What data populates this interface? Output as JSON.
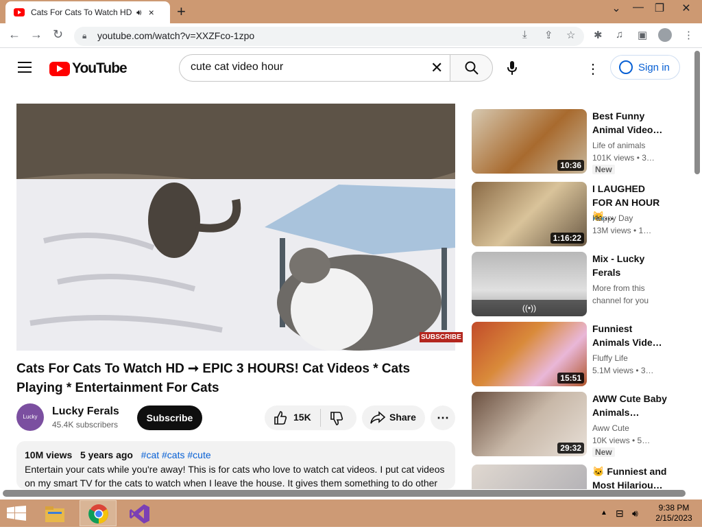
{
  "browser": {
    "tab_title": "Cats For Cats To Watch HD –",
    "url": "youtube.com/watch?v=XXZFco-1zpo",
    "new_tab": "+",
    "close_tab": "×",
    "minimize": "⌄",
    "restore": "—",
    "maximize": "❐",
    "close": "✕"
  },
  "youtube": {
    "logo_text": "YouTube",
    "search_value": "cute cat video hour",
    "signin_label": "Sign in"
  },
  "video": {
    "subscribe_badge": "SUBSCRIBE",
    "title": "Cats For Cats To Watch HD ➞ EPIC 3 HOURS! Cat Videos * Cats Playing * Entertainment For Cats",
    "channel_name": "Lucky Ferals",
    "channel_avatar_text": "Lucky Ferals",
    "channel_subs": "45.4K subscribers",
    "subscribe_label": "Subscribe",
    "like_count": "15K",
    "share_label": "Share",
    "views": "10M views",
    "age": "5 years ago",
    "tags": "#cat #cats #cute",
    "desc_line1": "Entertain your cats while you're away! This is for cats who love to watch cat videos. I put cat videos",
    "desc_line2": "on my smart TV for the cats to watch when I leave the house. It gives them something to do other"
  },
  "recommendations": [
    {
      "title": "Best Funny Animal Video…",
      "channel": "Life of animals",
      "stats": "101K views  • 3…",
      "duration": "10:36",
      "badge": "New"
    },
    {
      "title": "I LAUGHED FOR AN HOUR😹…",
      "channel": "Happy Day",
      "stats": "13M views  • 1…",
      "duration": "1:16:22",
      "badge": ""
    },
    {
      "title": "Mix - Lucky Ferals",
      "channel": "More from this",
      "stats": "channel for you",
      "duration": "",
      "badge": ""
    },
    {
      "title": "Funniest Animals Vide…",
      "channel": "Fluffy Life",
      "stats": "5.1M views  • 3…",
      "duration": "15:51",
      "badge": ""
    },
    {
      "title": "AWW Cute Baby Animals…",
      "channel": "Aww Cute",
      "stats": "10K views  • 5…",
      "duration": "29:32",
      "badge": "New"
    },
    {
      "title": "🐱 Funniest and Most Hilariou…",
      "channel": "",
      "stats": "",
      "duration": "",
      "badge": ""
    }
  ],
  "taskbar": {
    "time": "9:38 PM",
    "date": "2/15/2023"
  },
  "colors": {
    "youtube_red": "#ff0000",
    "link_blue": "#065fd4",
    "chrome_frame": "#cd9972"
  }
}
